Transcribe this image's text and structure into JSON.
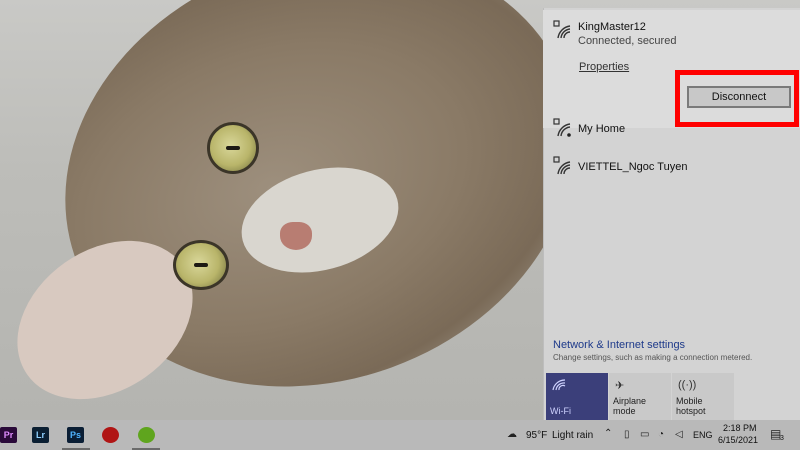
{
  "flyout": {
    "networks": [
      {
        "name": "KingMaster12",
        "status": "Connected, secured",
        "properties_label": "Properties",
        "disconnect_label": "Disconnect"
      },
      {
        "name": "My Home"
      },
      {
        "name": "VIETTEL_Ngoc Tuyen"
      }
    ],
    "settings": {
      "title": "Network & Internet settings",
      "subtitle": "Change settings, such as making a connection metered."
    },
    "quick_actions": [
      {
        "label": "Wi-Fi",
        "icon": "wifi-icon",
        "active": true
      },
      {
        "label": "Airplane mode",
        "icon": "airplane-icon",
        "active": false
      },
      {
        "label": "Mobile hotspot",
        "icon": "hotspot-icon",
        "active": false
      }
    ]
  },
  "taskbar": {
    "apps": [
      {
        "label": "Pr",
        "name": "premiere-icon",
        "color": "#2a0a3a",
        "text_color": "#e08cff"
      },
      {
        "label": "Lr",
        "name": "lightroom-icon",
        "color": "#0b1f33",
        "text_color": "#8fd0ff"
      },
      {
        "label": "Ps",
        "name": "photoshop-icon",
        "color": "#0a1e35",
        "text_color": "#4fb3ff"
      },
      {
        "label": "",
        "name": "red-app-icon",
        "color": "#b01515",
        "text_color": "#ffffff"
      },
      {
        "label": "",
        "name": "green-app-icon",
        "color": "#5fa51e",
        "text_color": "#ffffff"
      }
    ],
    "weather": {
      "temp": "95°F",
      "condition": "Light rain"
    },
    "language": "ENG",
    "time": "2:18 PM",
    "date": "6/15/2021",
    "notification_count": "3"
  },
  "colors": {
    "accent": "#3b3f7a",
    "highlight": "#ff0000",
    "link": "#1e3a8a"
  }
}
